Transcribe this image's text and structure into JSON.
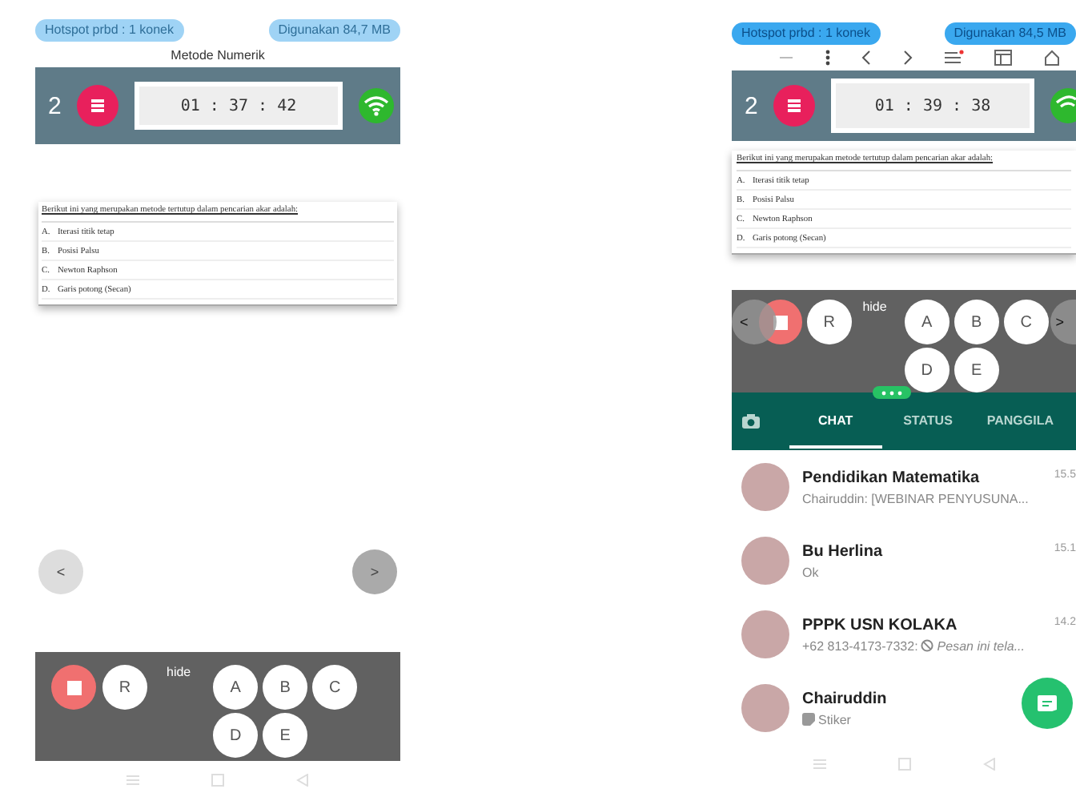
{
  "left_screen": {
    "status_pills": [
      "Hotspot prbd : 1 konek",
      "Digunakan 84,7 MB"
    ],
    "title": "Metode Numerik",
    "header": {
      "number": "2",
      "timer": "01 : 37 : 42"
    },
    "question": {
      "prompt": "Berikut ini yang merupakan metode tertutup dalam pencarian akar adalah:",
      "options": [
        {
          "letter": "A.",
          "text": "Iterasi titik tetap"
        },
        {
          "letter": "B.",
          "text": "Posisi Palsu"
        },
        {
          "letter": "C.",
          "text": "Newton Raphson"
        },
        {
          "letter": "D.",
          "text": "Garis potong (Secan)"
        }
      ]
    },
    "nav": {
      "prev": "<",
      "next": ">"
    },
    "panel": {
      "r_label": "R",
      "hide_label": "hide",
      "answers": [
        "A",
        "B",
        "C",
        "D",
        "E"
      ]
    }
  },
  "right_screen": {
    "status_pills": [
      "Hotspot prbd : 1 konek",
      "Digunakan 84,5 MB"
    ],
    "header": {
      "number": "2",
      "timer": "01 : 39 : 38"
    },
    "question": {
      "prompt": "Berikut ini yang merupakan metode tertutup dalam pencarian akar adalah:",
      "options": [
        {
          "letter": "A.",
          "text": "Iterasi titik tetap"
        },
        {
          "letter": "B.",
          "text": "Posisi Palsu"
        },
        {
          "letter": "C.",
          "text": "Newton Raphson"
        },
        {
          "letter": "D.",
          "text": "Garis potong (Secan)"
        }
      ]
    },
    "panel": {
      "prev": "<",
      "next": ">",
      "r_label": "R",
      "hide_label": "hide",
      "answers": [
        "A",
        "B",
        "C",
        "D",
        "E"
      ]
    },
    "chat_tabs": [
      {
        "label": "CHAT",
        "selected": true
      },
      {
        "label": "STATUS",
        "selected": false
      },
      {
        "label": "PANGGILA",
        "selected": false
      }
    ],
    "chats": [
      {
        "name": "Pendidikan Matematika",
        "time": "15.5",
        "preview": {
          "text": "Chairuddin: [WEBINAR PENYUSUNA...",
          "italic": false
        }
      },
      {
        "name": "Bu Herlina",
        "time": "15.1",
        "preview": {
          "text": "Ok",
          "italic": false
        }
      },
      {
        "name": "PPPK USN KOLAKA",
        "time": "14.2",
        "preview": {
          "prefix": "+62 813-4173-7332:",
          "kind": "deleted",
          "text": "Pesan ini tela...",
          "italic": true
        }
      },
      {
        "name": "Chairuddin",
        "preview": {
          "kind": "sticker",
          "text": "Stiker",
          "italic": false
        }
      }
    ]
  }
}
